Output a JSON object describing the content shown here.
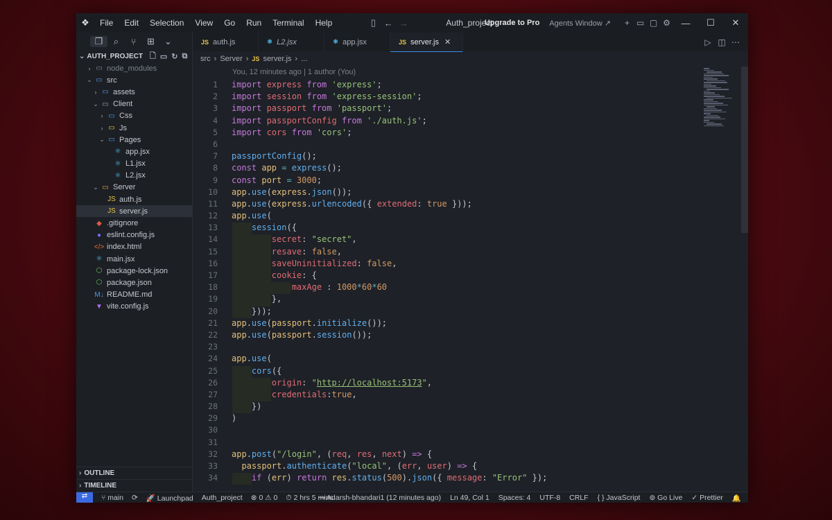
{
  "window": {
    "menu": [
      "File",
      "Edit",
      "Selection",
      "View",
      "Go",
      "Run",
      "Terminal",
      "Help"
    ],
    "title": "Auth_project",
    "upgrade_label": "Upgrade to Pro",
    "agents_label": "Agents Window ↗"
  },
  "sidebar": {
    "project": "AUTH_PROJECT",
    "tree": [
      {
        "label": "node_modules",
        "depth": 1,
        "chev": "›",
        "icon": "▭",
        "icon_color": "#7f8a99",
        "dim": true
      },
      {
        "label": "src",
        "depth": 1,
        "chev": "⌄",
        "icon": "▭",
        "icon_color": "#4f9be8"
      },
      {
        "label": "assets",
        "depth": 2,
        "chev": "›",
        "icon": "▭",
        "icon_color": "#4f9be8"
      },
      {
        "label": "Client",
        "depth": 2,
        "chev": "⌄",
        "icon": "▭",
        "icon_color": "#9aa3b0"
      },
      {
        "label": "Css",
        "depth": 3,
        "chev": "›",
        "icon": "▭",
        "icon_color": "#4f9be8"
      },
      {
        "label": "Js",
        "depth": 3,
        "chev": "›",
        "icon": "▭",
        "icon_color": "#e8c547"
      },
      {
        "label": "Pages",
        "depth": 3,
        "chev": "⌄",
        "icon": "▭",
        "icon_color": "#4f9be8"
      },
      {
        "label": "app.jsx",
        "depth": 4,
        "chev": "",
        "icon": "⚛",
        "icon_color": "#4fc3f7"
      },
      {
        "label": "L1.jsx",
        "depth": 4,
        "chev": "",
        "icon": "⚛",
        "icon_color": "#4fc3f7"
      },
      {
        "label": "L2.jsx",
        "depth": 4,
        "chev": "",
        "icon": "⚛",
        "icon_color": "#4fc3f7"
      },
      {
        "label": "Server",
        "depth": 2,
        "chev": "⌄",
        "icon": "▭",
        "icon_color": "#e8a34a"
      },
      {
        "label": "auth.js",
        "depth": 3,
        "chev": "",
        "icon": "JS",
        "icon_color": "#e8c547"
      },
      {
        "label": "server.js",
        "depth": 3,
        "chev": "",
        "icon": "JS",
        "icon_color": "#e8c547",
        "selected": true
      },
      {
        "label": ".gitignore",
        "depth": 1,
        "chev": "",
        "icon": "◆",
        "icon_color": "#e0584a"
      },
      {
        "label": "eslint.config.js",
        "depth": 1,
        "chev": "",
        "icon": "●",
        "icon_color": "#7b6cf0"
      },
      {
        "label": "index.html",
        "depth": 1,
        "chev": "",
        "icon": "</>",
        "icon_color": "#e8703a"
      },
      {
        "label": "main.jsx",
        "depth": 1,
        "chev": "",
        "icon": "⚛",
        "icon_color": "#4fc3f7"
      },
      {
        "label": "package-lock.json",
        "depth": 1,
        "chev": "",
        "icon": "⬡",
        "icon_color": "#6cbf4f"
      },
      {
        "label": "package.json",
        "depth": 1,
        "chev": "",
        "icon": "⬡",
        "icon_color": "#6cbf4f"
      },
      {
        "label": "README.md",
        "depth": 1,
        "chev": "",
        "icon": "M↓",
        "icon_color": "#4f9be8"
      },
      {
        "label": "vite.config.js",
        "depth": 1,
        "chev": "",
        "icon": "▼",
        "icon_color": "#b36cf0"
      }
    ],
    "outline": "OUTLINE",
    "timeline": "TIMELINE"
  },
  "tabs": [
    {
      "label": "auth.js",
      "icon": "JS",
      "icon_color": "#e8c547"
    },
    {
      "label": "L2.jsx",
      "icon": "⚛",
      "icon_color": "#4fc3f7",
      "italic": true
    },
    {
      "label": "app.jsx",
      "icon": "⚛",
      "icon_color": "#4fc3f7"
    },
    {
      "label": "server.js",
      "icon": "JS",
      "icon_color": "#e8c547",
      "active": true
    }
  ],
  "breadcrumb": [
    "src",
    "›",
    "Server",
    "›",
    "JS",
    "server.js",
    "›",
    "..."
  ],
  "blame": "You, 12 minutes ago | 1 author (You)",
  "code": [
    [
      [
        "import ",
        "k"
      ],
      [
        "express ",
        "p"
      ],
      [
        "from ",
        "k"
      ],
      [
        "'express'",
        "s"
      ],
      [
        ";",
        "w"
      ]
    ],
    [
      [
        "import ",
        "k"
      ],
      [
        "session ",
        "p"
      ],
      [
        "from ",
        "k"
      ],
      [
        "'express-session'",
        "s"
      ],
      [
        ";",
        "w"
      ]
    ],
    [
      [
        "import ",
        "k"
      ],
      [
        "passport ",
        "p"
      ],
      [
        "from ",
        "k"
      ],
      [
        "'passport'",
        "s"
      ],
      [
        ";",
        "w"
      ]
    ],
    [
      [
        "import ",
        "k"
      ],
      [
        "passportConfig ",
        "p"
      ],
      [
        "from ",
        "k"
      ],
      [
        "'./auth.js'",
        "s"
      ],
      [
        ";",
        "w"
      ]
    ],
    [
      [
        "import ",
        "k"
      ],
      [
        "cors ",
        "p"
      ],
      [
        "from ",
        "k"
      ],
      [
        "'cors'",
        "s"
      ],
      [
        ";",
        "w"
      ]
    ],
    [],
    [
      [
        "passportConfig",
        "f"
      ],
      [
        "();",
        "w"
      ]
    ],
    [
      [
        "const ",
        "k"
      ],
      [
        "app ",
        "v"
      ],
      [
        "= ",
        "o"
      ],
      [
        "express",
        "f"
      ],
      [
        "();",
        "w"
      ]
    ],
    [
      [
        "const ",
        "k"
      ],
      [
        "port ",
        "v"
      ],
      [
        "= ",
        "o"
      ],
      [
        "3000",
        "n"
      ],
      [
        ";",
        "w"
      ]
    ],
    [
      [
        "app",
        "v"
      ],
      [
        ".",
        "w"
      ],
      [
        "use",
        "f"
      ],
      [
        "(",
        "w"
      ],
      [
        "express",
        "v"
      ],
      [
        ".",
        "w"
      ],
      [
        "json",
        "f"
      ],
      [
        "());",
        "w"
      ]
    ],
    [
      [
        "app",
        "v"
      ],
      [
        ".",
        "w"
      ],
      [
        "use",
        "f"
      ],
      [
        "(",
        "w"
      ],
      [
        "express",
        "v"
      ],
      [
        ".",
        "w"
      ],
      [
        "urlencoded",
        "f"
      ],
      [
        "({ ",
        "w"
      ],
      [
        "extended",
        "p"
      ],
      [
        ": ",
        "w"
      ],
      [
        "true ",
        "n"
      ],
      [
        "}));",
        "w"
      ]
    ],
    [
      [
        "app",
        "v"
      ],
      [
        ".",
        "w"
      ],
      [
        "use",
        "f"
      ],
      [
        "(",
        "w"
      ]
    ],
    [
      [
        "    ",
        "w"
      ],
      [
        "session",
        "f"
      ],
      [
        "({",
        "w"
      ]
    ],
    [
      [
        "        ",
        "w"
      ],
      [
        "secret",
        "p"
      ],
      [
        ": ",
        "w"
      ],
      [
        "\"secret\"",
        "s"
      ],
      [
        ",",
        "w"
      ]
    ],
    [
      [
        "        ",
        "w"
      ],
      [
        "resave",
        "p"
      ],
      [
        ": ",
        "w"
      ],
      [
        "false",
        "n"
      ],
      [
        ",",
        "w"
      ]
    ],
    [
      [
        "        ",
        "w"
      ],
      [
        "saveUninitialized",
        "p"
      ],
      [
        ": ",
        "w"
      ],
      [
        "false",
        "n"
      ],
      [
        ",",
        "w"
      ]
    ],
    [
      [
        "        ",
        "w"
      ],
      [
        "cookie",
        "p"
      ],
      [
        ": {",
        "w"
      ]
    ],
    [
      [
        "            ",
        "w"
      ],
      [
        "maxAge ",
        "p"
      ],
      [
        ": ",
        "w"
      ],
      [
        "1000",
        "n"
      ],
      [
        "*",
        "o"
      ],
      [
        "60",
        "n"
      ],
      [
        "*",
        "o"
      ],
      [
        "60",
        "n"
      ]
    ],
    [
      [
        "        },",
        "w"
      ]
    ],
    [
      [
        "    }));",
        "w"
      ]
    ],
    [
      [
        "app",
        "v"
      ],
      [
        ".",
        "w"
      ],
      [
        "use",
        "f"
      ],
      [
        "(",
        "w"
      ],
      [
        "passport",
        "v"
      ],
      [
        ".",
        "w"
      ],
      [
        "initialize",
        "f"
      ],
      [
        "());",
        "w"
      ]
    ],
    [
      [
        "app",
        "v"
      ],
      [
        ".",
        "w"
      ],
      [
        "use",
        "f"
      ],
      [
        "(",
        "w"
      ],
      [
        "passport",
        "v"
      ],
      [
        ".",
        "w"
      ],
      [
        "session",
        "f"
      ],
      [
        "());",
        "w"
      ]
    ],
    [],
    [
      [
        "app",
        "v"
      ],
      [
        ".",
        "w"
      ],
      [
        "use",
        "f"
      ],
      [
        "(",
        "w"
      ]
    ],
    [
      [
        "    ",
        "w"
      ],
      [
        "cors",
        "f"
      ],
      [
        "({",
        "w"
      ]
    ],
    [
      [
        "        ",
        "w"
      ],
      [
        "origin",
        "p"
      ],
      [
        ": ",
        "w"
      ],
      [
        "\"",
        "s"
      ],
      [
        "http://localhost:5173",
        "s"
      ],
      [
        "\"",
        "s"
      ],
      [
        ",",
        "w"
      ]
    ],
    [
      [
        "        ",
        "w"
      ],
      [
        "credentials",
        "p"
      ],
      [
        ":",
        "w"
      ],
      [
        "true",
        "n"
      ],
      [
        ",",
        "w"
      ]
    ],
    [
      [
        "    })",
        "w"
      ]
    ],
    [
      [
        ")",
        "w"
      ]
    ],
    [],
    [],
    [
      [
        "app",
        "v"
      ],
      [
        ".",
        "w"
      ],
      [
        "post",
        "f"
      ],
      [
        "(",
        "w"
      ],
      [
        "\"/login\"",
        "s"
      ],
      [
        ", (",
        "w"
      ],
      [
        "req",
        "p"
      ],
      [
        ", ",
        "w"
      ],
      [
        "res",
        "p"
      ],
      [
        ", ",
        "w"
      ],
      [
        "next",
        "p"
      ],
      [
        ") ",
        "w"
      ],
      [
        "=> ",
        "k"
      ],
      [
        "{",
        "w"
      ]
    ],
    [
      [
        "  ",
        "w"
      ],
      [
        "passport",
        "v"
      ],
      [
        ".",
        "w"
      ],
      [
        "authenticate",
        "f"
      ],
      [
        "(",
        "w"
      ],
      [
        "\"local\"",
        "s"
      ],
      [
        ", (",
        "w"
      ],
      [
        "err",
        "p"
      ],
      [
        ", ",
        "w"
      ],
      [
        "user",
        "p"
      ],
      [
        ") ",
        "w"
      ],
      [
        "=> ",
        "k"
      ],
      [
        "{",
        "w"
      ]
    ],
    [
      [
        "    ",
        "w"
      ],
      [
        "if ",
        "k"
      ],
      [
        "(",
        "w"
      ],
      [
        "err",
        "v"
      ],
      [
        ") ",
        "w"
      ],
      [
        "return ",
        "k"
      ],
      [
        "res",
        "v"
      ],
      [
        ".",
        "w"
      ],
      [
        "status",
        "f"
      ],
      [
        "(",
        "w"
      ],
      [
        "500",
        "n"
      ],
      [
        ").",
        "w"
      ],
      [
        "json",
        "f"
      ],
      [
        "({ ",
        "w"
      ],
      [
        "message",
        "p"
      ],
      [
        ": ",
        "w"
      ],
      [
        "\"Error\"",
        "s"
      ],
      [
        " });",
        "w"
      ]
    ]
  ],
  "status": {
    "branch": "main",
    "launchpad": "Launchpad",
    "project": "Auth_project",
    "problems": "⊗ 0 ⚠ 0",
    "time": "2 hrs 5 mins",
    "blame": "Adarsh-bhandari1 (12 minutes ago)",
    "position": "Ln 49, Col 1",
    "spaces": "Spaces: 4",
    "encoding": "UTF-8",
    "eol": "CRLF",
    "language": "{ } JavaScript",
    "golive": "Go Live",
    "prettier": "Prettier"
  }
}
